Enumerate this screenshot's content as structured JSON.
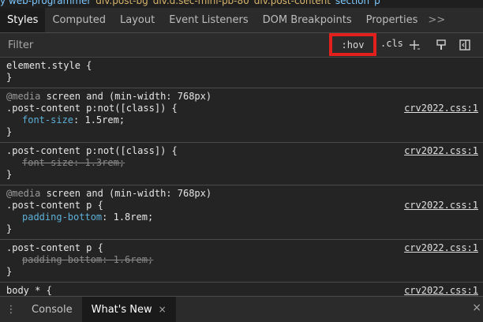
{
  "breadcrumb": [
    {
      "text": "y web-programmer",
      "kind": "tag"
    },
    {
      "text": "div.post-bg",
      "kind": "cls"
    },
    {
      "text": "div.d.sec-mini-pb-80",
      "kind": "cls"
    },
    {
      "text": "div.post-content",
      "kind": "cls"
    },
    {
      "text": "section",
      "kind": "tag"
    },
    {
      "text": "p",
      "kind": "tag"
    }
  ],
  "tabs": [
    "Styles",
    "Computed",
    "Layout",
    "Event Listeners",
    "DOM Breakpoints",
    "Properties"
  ],
  "tabs_more": ">>",
  "filter": {
    "placeholder": "Filter",
    "hov_label": ":hov",
    "cls_label": ".cls"
  },
  "rules": [
    {
      "media": "",
      "selector": "element.style {",
      "source": "",
      "props": [],
      "close": "}"
    },
    {
      "media": "screen and (min-width: 768px)",
      "media_kw": "@media",
      "selector": ".post-content p:not([class]) {",
      "source": "crv2022.css:1",
      "props": [
        {
          "name": "font-size",
          "value": "1.5rem;",
          "struck": false
        }
      ],
      "close": "}"
    },
    {
      "media": "",
      "selector": ".post-content p:not([class]) {",
      "source": "crv2022.css:1",
      "props": [
        {
          "name": "font-size",
          "value": "1.3rem;",
          "struck": true
        }
      ],
      "close": "}"
    },
    {
      "media": "screen and (min-width: 768px)",
      "media_kw": "@media",
      "selector": ".post-content p {",
      "source": "crv2022.css:1",
      "props": [
        {
          "name": "padding-bottom",
          "value": "1.8rem;",
          "struck": false
        }
      ],
      "close": "}"
    },
    {
      "media": "",
      "selector": ".post-content p {",
      "source": "crv2022.css:1",
      "props": [
        {
          "name": "padding-bottom",
          "value": "1.6rem;",
          "struck": true
        }
      ],
      "close": "}"
    },
    {
      "media": "",
      "selector": "body * {",
      "source": "crv2022.css:1",
      "props": [],
      "close": ""
    }
  ],
  "drawer": {
    "tabs": [
      "Console",
      "What's New"
    ],
    "active": 1,
    "close_glyph": "×"
  },
  "colors": {
    "highlight_border": "#e2211c",
    "property_name": "#5db0d7",
    "background": "#242424"
  },
  "icons": [
    "new-rule-icon",
    "paint-brush-icon",
    "sidebar-toggle-icon",
    "kebab-menu-icon",
    "close-icon"
  ]
}
